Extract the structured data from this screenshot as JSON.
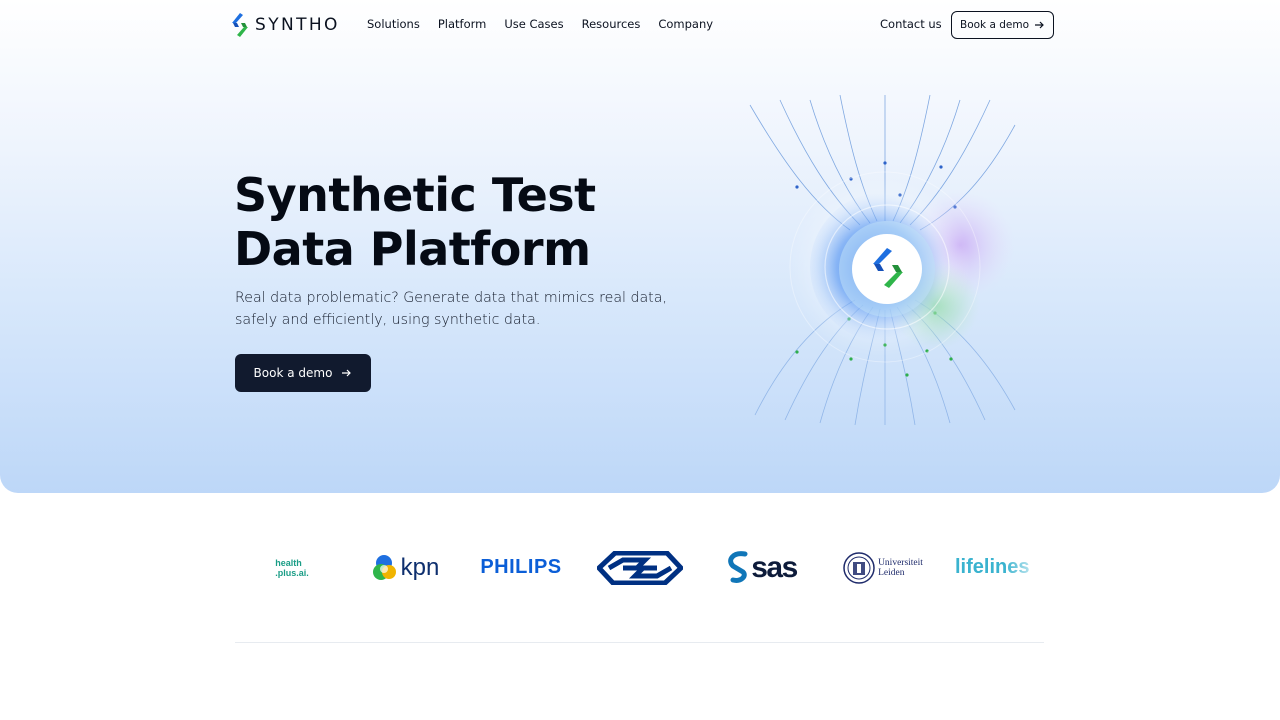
{
  "brand": {
    "name": "SYNTHO"
  },
  "nav": {
    "links": [
      "Solutions",
      "Platform",
      "Use Cases",
      "Resources",
      "Company"
    ],
    "contact": "Contact us",
    "cta": "Book a demo"
  },
  "hero": {
    "title_line1": "Synthetic Test",
    "title_line2": "Data Platform",
    "subtitle_line1": "Real data problematic? Generate data that mimics real data,",
    "subtitle_line2": "safely and efficiently, using synthetic data.",
    "cta": "Book a demo"
  },
  "clients": [
    {
      "name": "health plus.ai",
      "line1": "health",
      "line2": ".plus.ai."
    },
    {
      "name": "kpn",
      "text": "kpn"
    },
    {
      "name": "PHILIPS",
      "text": "PHILIPS"
    },
    {
      "name": "NS"
    },
    {
      "name": "sas",
      "text": "sas"
    },
    {
      "name": "Universiteit Leiden",
      "line1": "Universiteit",
      "line2": "Leiden"
    },
    {
      "name": "lifelines",
      "text": "lifelines"
    }
  ],
  "colors": {
    "brand_blue": "#1e6fe0",
    "brand_green": "#2fb54a",
    "dark": "#111a2e"
  },
  "icons": [
    "arrow-right-icon",
    "syntho-logo-icon"
  ]
}
